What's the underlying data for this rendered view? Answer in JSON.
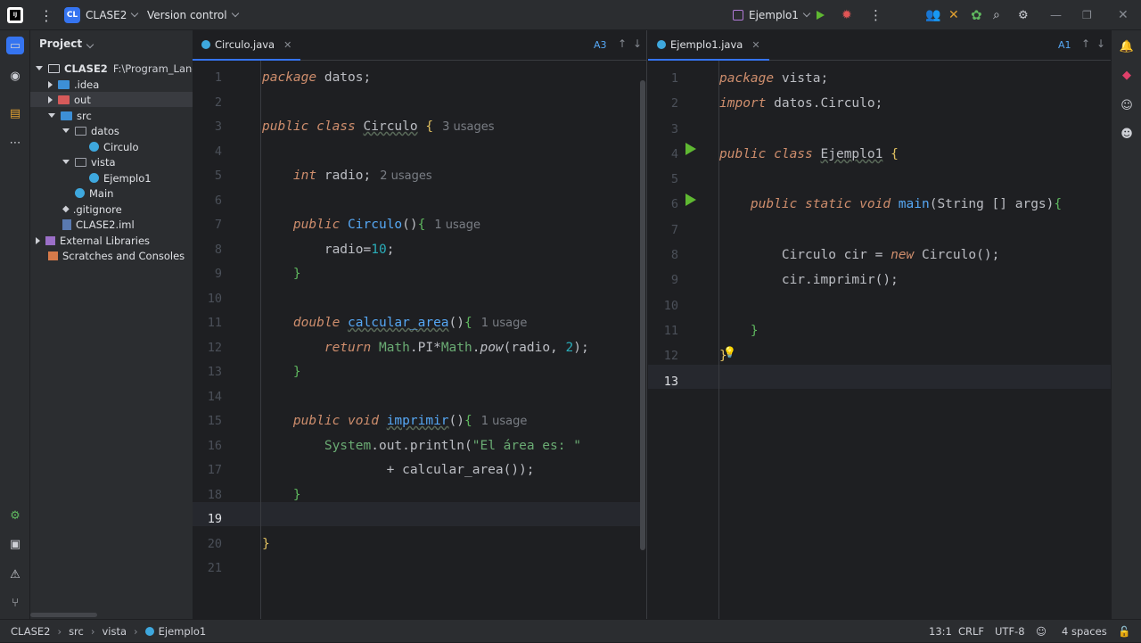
{
  "titlebar": {
    "project_badge": "CL",
    "project_name": "CLASE2",
    "vcs": "Version control",
    "run_config": "Ejemplo1"
  },
  "project_panel": {
    "title": "Project",
    "root": "CLASE2",
    "root_path": "F:\\Program_Langua",
    "items": [
      {
        "label": ".idea"
      },
      {
        "label": "out"
      },
      {
        "label": "src"
      },
      {
        "label": "datos"
      },
      {
        "label": "Circulo"
      },
      {
        "label": "vista"
      },
      {
        "label": "Ejemplo1"
      },
      {
        "label": "Main"
      },
      {
        "label": ".gitignore"
      },
      {
        "label": "CLASE2.iml"
      },
      {
        "label": "External Libraries"
      },
      {
        "label": "Scratches and Consoles"
      }
    ]
  },
  "left_editor": {
    "tab": "Circulo.java",
    "inspection_count": "3",
    "line_numbers": [
      "1",
      "2",
      "3",
      "4",
      "5",
      "6",
      "7",
      "8",
      "9",
      "10",
      "11",
      "12",
      "13",
      "14",
      "15",
      "16",
      "17",
      "18",
      "19",
      "20",
      "21"
    ],
    "hints": {
      "class_usages": "3 usages",
      "radio_usages": "2 usages",
      "ctor_usages": "1 usage",
      "calc_usages": "1 usage",
      "print_usages": "1 usage"
    }
  },
  "right_editor": {
    "tab": "Ejemplo1.java",
    "inspection_count": "1",
    "line_numbers": [
      "1",
      "2",
      "3",
      "4",
      "5",
      "6",
      "7",
      "8",
      "9",
      "10",
      "11",
      "12",
      "13"
    ]
  },
  "statusbar": {
    "breadcrumb": [
      "CLASE2",
      "src",
      "vista",
      "Ejemplo1"
    ],
    "position": "13:1",
    "line_sep": "CRLF",
    "encoding": "UTF-8",
    "indent": "4 spaces"
  }
}
